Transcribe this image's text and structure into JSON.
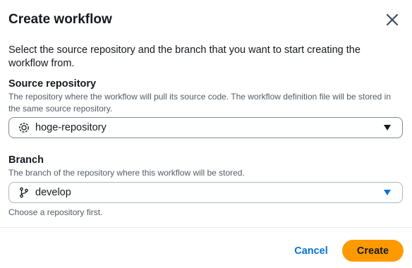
{
  "dialog": {
    "title": "Create workflow",
    "close_icon": "close-icon",
    "intro": "Select the source repository and the branch that you want to start creating the workflow from."
  },
  "source_repository": {
    "label": "Source repository",
    "description": "The repository where the workflow will pull its source code. The workflow definition file will be stored in the same source repository.",
    "value": "hoge-repository",
    "icon": "repository-icon"
  },
  "branch": {
    "label": "Branch",
    "description": "The branch of the repository where this workflow will be stored.",
    "value": "develop",
    "icon": "git-branch-icon",
    "hint": "Choose a repository first."
  },
  "footer": {
    "cancel_label": "Cancel",
    "create_label": "Create"
  },
  "colors": {
    "primary_button": "#ff9900",
    "link": "#0972d3",
    "text": "#16191f",
    "secondary_text": "#545b64"
  }
}
